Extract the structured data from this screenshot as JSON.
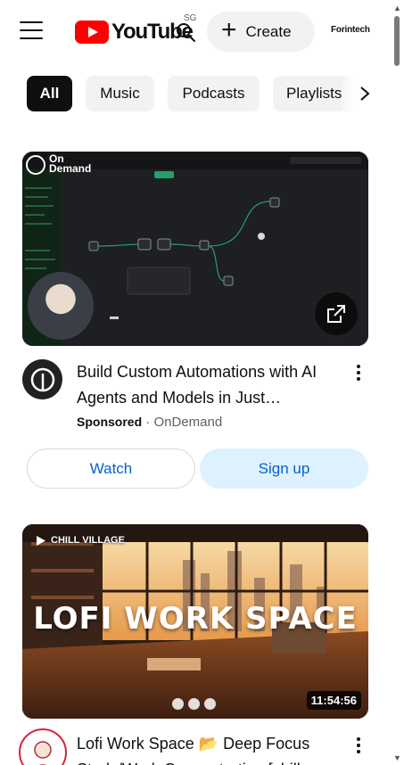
{
  "header": {
    "logo_text": "YouTube",
    "region_code": "SG",
    "create_label": "Create",
    "channel_logo_text": "Forintech"
  },
  "chips": [
    {
      "label": "All",
      "active": true
    },
    {
      "label": "Music",
      "active": false
    },
    {
      "label": "Podcasts",
      "active": false
    },
    {
      "label": "Playlists",
      "active": false
    }
  ],
  "ad": {
    "thumbnail_brand": "On Demand",
    "title": "Build Custom Automations with AI Agents and Models in Just…",
    "sponsored_label": "Sponsored",
    "separator": "·",
    "advertiser": "OnDemand",
    "watch_label": "Watch",
    "signup_label": "Sign up"
  },
  "video": {
    "channel_tag": "CHILL VILLAGE",
    "overlay_title": "LOFI WORK SPACE",
    "duration": "11:54:56",
    "title_line1": "Lofi Work Space 📂 Deep Focus",
    "title_line2": "Study/Work Concentration [chill"
  },
  "colors": {
    "brand_red": "#ff0000",
    "link_blue": "#065fd4",
    "signup_bg": "#def1ff",
    "chip_bg": "#f2f2f2",
    "chip_active_bg": "#0f0f0f"
  }
}
